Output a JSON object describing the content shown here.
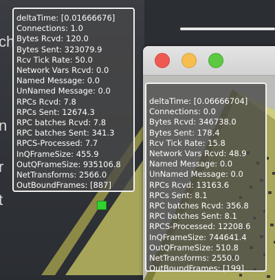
{
  "background": {
    "left_text": [
      "ch",
      "n",
      "r",
      "t"
    ]
  },
  "main_stats": {
    "lines": [
      "deltaTime: [0.01666676]",
      "Connections: 1.0",
      "Bytes Rcvd: 120.0",
      "Bytes Sent: 323079.9",
      "Rcv Tick Rate: 50.0",
      "Network Vars Rcvd: 0.0",
      "Named Message: 0.0",
      "UnNamed Message: 0.0",
      "RPCs Rcvd: 7.8",
      "RPCs Sent: 12674.3",
      "RPC batches Rcvd: 7.8",
      "RPC batches Sent: 341.3",
      "RPCS-Processed: 7.7",
      "InQFrameSize: 455.9",
      "OutQFrameSize: 935106.8",
      "NetTransforms: 2566.0",
      "OutBoundFrames: [887]"
    ]
  },
  "secondary_stats": {
    "lines": [
      "deltaTime: [0.06666704]",
      "Connections: 0.0",
      "Bytes Rcvd: 346738.0",
      "Bytes Sent: 178.4",
      "Rcv Tick Rate: 15.8",
      "Network Vars Rcvd: 48.9",
      "Named Message: 0.0",
      "UnNamed Message: 0.0",
      "RPCs Rcvd: 13163.6",
      "RPCs Sent: 8.1",
      "RPC batches Rcvd: 356.8",
      "RPC batches Sent: 8.1",
      "RPCS-Processed: 12208.6",
      "InQFrameSize: 744641.4",
      "OutQFrameSize: 510.8",
      "NetTransforms: 2550.0",
      "OutBoundFrames: [199]"
    ]
  },
  "colors": {
    "window_close": "#ee5a52",
    "window_minimize": "#f5be4f",
    "window_maximize": "#5dc842",
    "player_cube": "#2ed52e"
  }
}
